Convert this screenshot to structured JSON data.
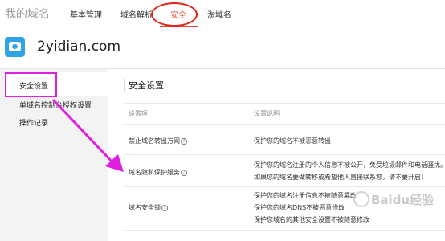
{
  "nav": {
    "title": "我的域名",
    "items": [
      "基本管理",
      "域名解析",
      "安全",
      "淘域名"
    ]
  },
  "domain": {
    "name": "2yidian.com"
  },
  "sidebar": {
    "items": [
      "安全设置",
      "单域名控制台授权设置",
      "操作记录"
    ]
  },
  "main": {
    "title": "安全设置",
    "headers": [
      "设置项",
      "设置说明"
    ],
    "rows": [
      {
        "label": "禁止域名转出万网",
        "desc": [
          "保护您的域名不被恶意转出"
        ]
      },
      {
        "label": "域名隐私保护服务",
        "desc": [
          "保护您的域名注册的个人信息不被公开，免受垃圾邮件和电话骚扰。",
          "如果您的域名要做转移或希望他人直接联系您，请不要开启！"
        ]
      },
      {
        "label": "域名安全锁",
        "desc": [
          "保护您的域名注册信息不被随意篡改",
          "保护您的域名DNS不被恶意修改",
          "保护您域名的其他安全设置不被随意修改"
        ]
      }
    ]
  },
  "watermark": "Baidu经验",
  "colors": {
    "accent": "#e34b3a",
    "highlight_box": "#e020e0",
    "arrow": "#e020e0"
  }
}
